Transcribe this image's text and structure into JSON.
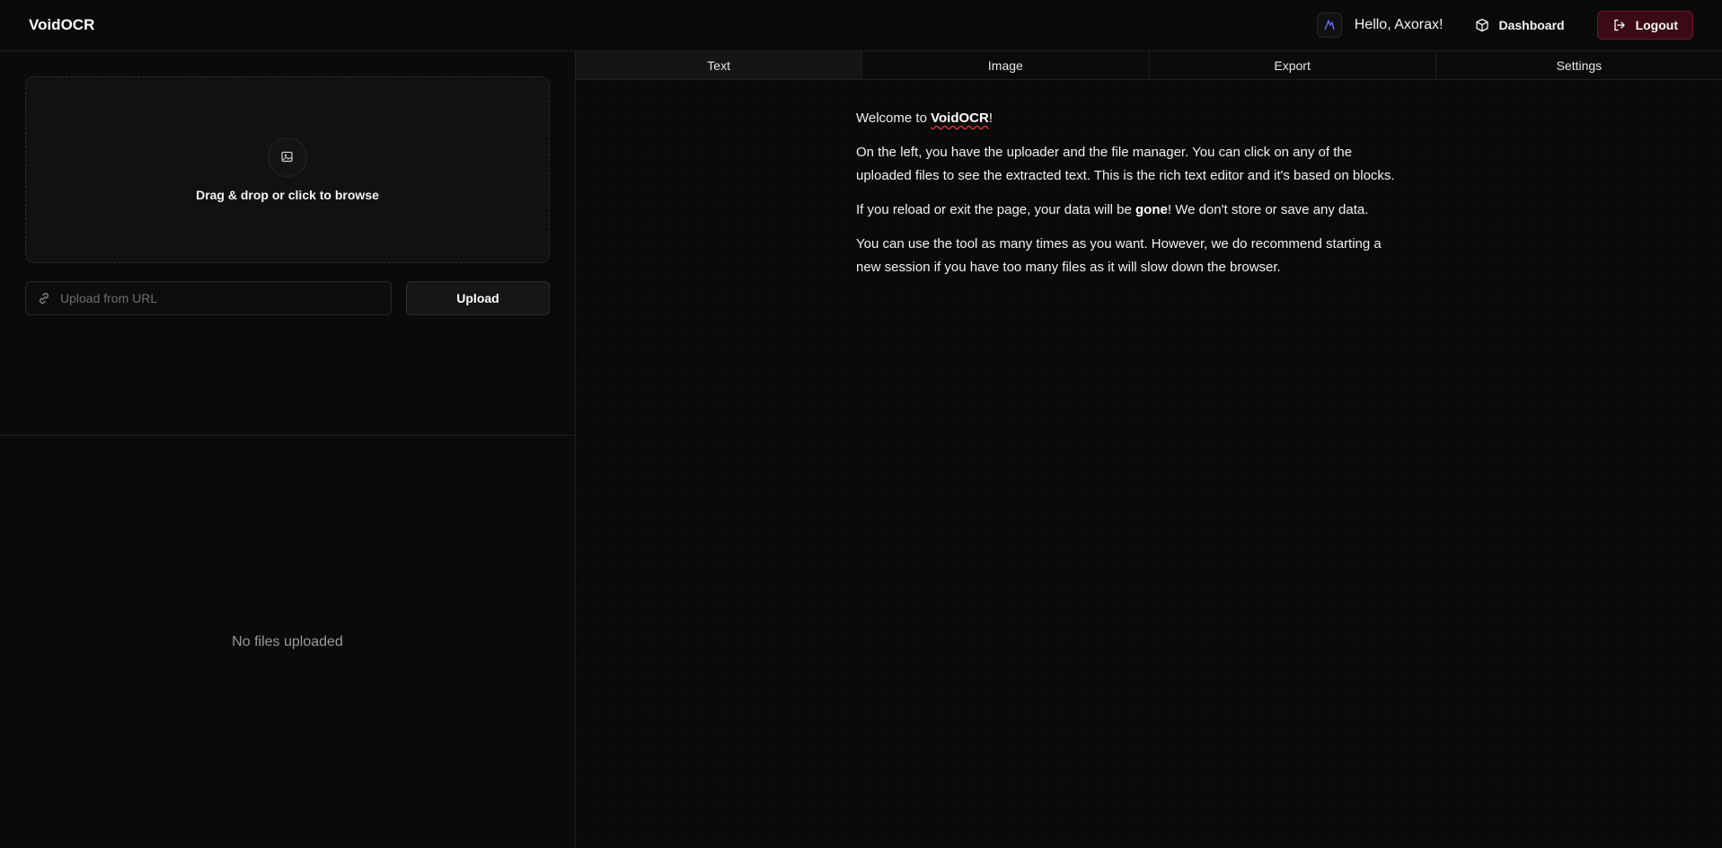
{
  "header": {
    "brand": "VoidOCR",
    "greeting": "Hello, Axorax!",
    "dashboard_label": "Dashboard",
    "logout_label": "Logout",
    "icons": {
      "avatar": "avatar-icon",
      "dashboard": "box-icon",
      "logout": "logout-icon"
    }
  },
  "uploader": {
    "dropzone_text": "Drag & drop or click to browse",
    "url_placeholder": "Upload from URL",
    "url_value": "",
    "upload_label": "Upload",
    "icons": {
      "dropzone": "image-upload-icon",
      "url": "link-icon"
    }
  },
  "file_manager": {
    "empty_text": "No files uploaded"
  },
  "tabs": [
    {
      "label": "Text",
      "active": true
    },
    {
      "label": "Image",
      "active": false
    },
    {
      "label": "Export",
      "active": false
    },
    {
      "label": "Settings",
      "active": false
    }
  ],
  "editor": {
    "p1_before": "Welcome to ",
    "p1_brand": "VoidOCR",
    "p1_after": "!",
    "p2_line1": "On the left, you have the uploader and the file manager. You can click on any of the",
    "p2_line2": "uploaded files to see the extracted text. This is the rich text editor and it's based on blocks.",
    "p3_before": "If you reload or exit the page, your data will be ",
    "p3_bold": "gone",
    "p3_after": "! We don't store or save any data.",
    "p4_line1": "You can use the tool as many times as you want. However, we do recommend starting a",
    "p4_line2": "new session if you have too many files as it will slow down the browser."
  },
  "colors": {
    "background": "#0a0a0a",
    "logout_bg": "#3a0b14",
    "logout_border": "#6b1a2a",
    "avatar_accent": "#5b6cff"
  }
}
